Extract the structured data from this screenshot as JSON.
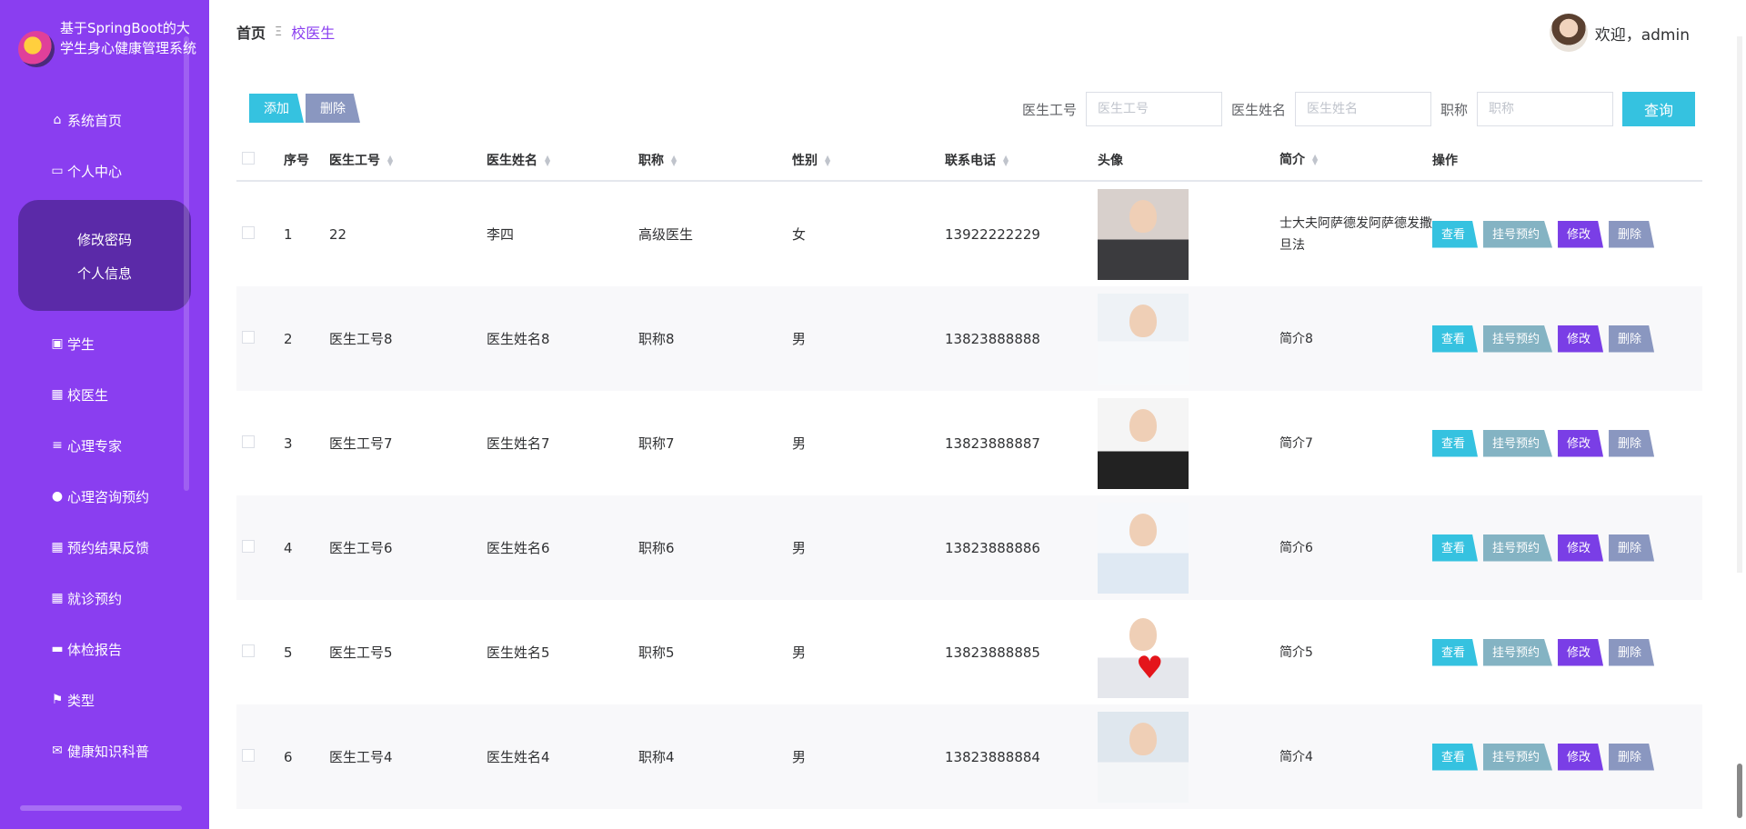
{
  "app": {
    "title": "基于SpringBoot的大学生身心健康管理系统"
  },
  "sidebar": {
    "items": [
      {
        "label": "系统首页",
        "icon": "home-icon"
      },
      {
        "label": "个人中心",
        "icon": "card-icon"
      },
      {
        "label": "学生",
        "icon": "clipboard-icon"
      },
      {
        "label": "校医生",
        "icon": "grid-icon"
      },
      {
        "label": "心理专家",
        "icon": "list-icon"
      },
      {
        "label": "心理咨询预约",
        "icon": "user-icon"
      },
      {
        "label": "预约结果反馈",
        "icon": "grid-icon"
      },
      {
        "label": "就诊预约",
        "icon": "grid-icon"
      },
      {
        "label": "体检报告",
        "icon": "monitor-icon"
      },
      {
        "label": "类型",
        "icon": "flag-icon"
      },
      {
        "label": "健康知识科普",
        "icon": "mail-icon"
      }
    ],
    "submenu": [
      {
        "label": "修改密码"
      },
      {
        "label": "个人信息"
      }
    ]
  },
  "header": {
    "breadcrumb": {
      "home": "首页",
      "separator": "Ξ",
      "current": "校医生"
    },
    "welcome": "欢迎，admin"
  },
  "toolbar": {
    "add_label": "添加",
    "delete_label": "删除",
    "search": {
      "doctor_no_label": "医生工号",
      "doctor_no_placeholder": "医生工号",
      "doctor_name_label": "医生姓名",
      "doctor_name_placeholder": "医生姓名",
      "title_label": "职称",
      "title_placeholder": "职称",
      "query_label": "查询"
    }
  },
  "table": {
    "columns": {
      "index": "序号",
      "doctor_no": "医生工号",
      "doctor_name": "医生姓名",
      "title": "职称",
      "gender": "性别",
      "phone": "联系电话",
      "photo": "头像",
      "intro": "简介",
      "ops": "操作"
    },
    "rows": [
      {
        "index": "1",
        "doctor_no": "22",
        "doctor_name": "李四",
        "title": "高级医生",
        "gender": "女",
        "phone": "13922222229",
        "intro": "士大夫阿萨德发阿萨德发撒旦法"
      },
      {
        "index": "2",
        "doctor_no": "医生工号8",
        "doctor_name": "医生姓名8",
        "title": "职称8",
        "gender": "男",
        "phone": "13823888888",
        "intro": "简介8"
      },
      {
        "index": "3",
        "doctor_no": "医生工号7",
        "doctor_name": "医生姓名7",
        "title": "职称7",
        "gender": "男",
        "phone": "13823888887",
        "intro": "简介7"
      },
      {
        "index": "4",
        "doctor_no": "医生工号6",
        "doctor_name": "医生姓名6",
        "title": "职称6",
        "gender": "男",
        "phone": "13823888886",
        "intro": "简介6"
      },
      {
        "index": "5",
        "doctor_no": "医生工号5",
        "doctor_name": "医生姓名5",
        "title": "职称5",
        "gender": "男",
        "phone": "13823888885",
        "intro": "简介5"
      },
      {
        "index": "6",
        "doctor_no": "医生工号4",
        "doctor_name": "医生姓名4",
        "title": "职称4",
        "gender": "男",
        "phone": "13823888884",
        "intro": "简介4"
      }
    ],
    "ops": {
      "view": "查看",
      "book": "挂号预约",
      "edit": "修改",
      "delete": "删除"
    }
  },
  "colors": {
    "sidebar": "#8a3ef0",
    "submenu": "#5b2aa8",
    "accent_cyan": "#35c2e0",
    "accent_purple": "#7a3ee6",
    "muted_blue": "#8a97c0"
  }
}
